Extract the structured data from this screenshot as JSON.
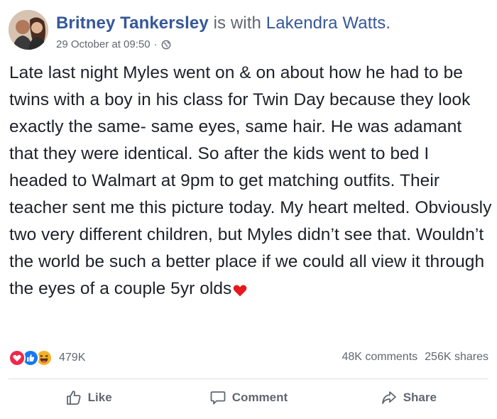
{
  "post": {
    "author": "Britney Tankersley",
    "with_text": "is with",
    "tagged": "Lakendra Watts.",
    "timestamp": "29 October at 09:50",
    "separator": "·",
    "privacy_icon": "globe-icon",
    "text": "Late last night Myles went on & on about how he had to be twins with a boy in his class for Twin Day because they look exactly the same- same eyes, same hair. He was adamant that they were identical. So after the kids went to bed I headed to Walmart at 9pm to get matching outfits. Their teacher sent me this picture today. My heart melted. Obviously two very different children, but Myles didn’t see that. Wouldn’t the world be such a better place if we could all view it through the eyes of a couple 5yr olds",
    "text_emoji": "heart-emoji"
  },
  "reactions": {
    "icons": [
      "love-reaction-icon",
      "like-reaction-icon",
      "haha-reaction-icon"
    ],
    "count": "479K",
    "comments": "48K comments",
    "shares": "256K shares"
  },
  "actions": {
    "like": "Like",
    "comment": "Comment",
    "share": "Share"
  },
  "colors": {
    "link_blue": "#365899",
    "meta_gray": "#616770",
    "love_red": "#f0284a",
    "like_blue": "#1877f2",
    "haha_yellow": "#f7b125"
  }
}
